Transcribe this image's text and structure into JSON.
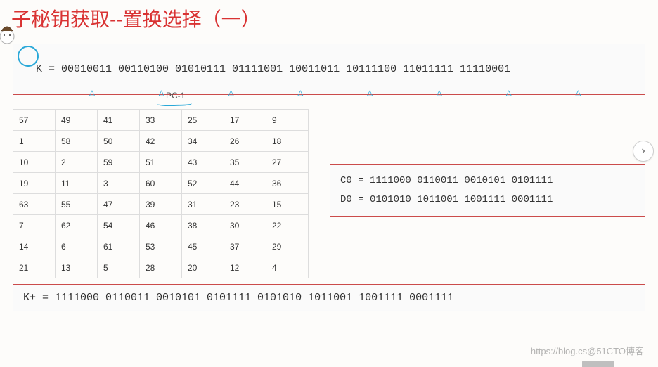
{
  "title": "子秘钥获取--置换选择（一）",
  "k_box": "K = 00010011 00110100 01010111 01111001 10011011 10111100 11011111 11110001",
  "pc1_label": "PC-1",
  "chart_data": {
    "type": "table",
    "title": "PC-1",
    "rows": [
      [
        57,
        49,
        41,
        33,
        25,
        17,
        9
      ],
      [
        1,
        58,
        50,
        42,
        34,
        26,
        18
      ],
      [
        10,
        2,
        59,
        51,
        43,
        35,
        27
      ],
      [
        19,
        11,
        3,
        60,
        52,
        44,
        36
      ],
      [
        63,
        55,
        47,
        39,
        31,
        23,
        15
      ],
      [
        7,
        62,
        54,
        46,
        38,
        30,
        22
      ],
      [
        14,
        6,
        61,
        53,
        45,
        37,
        29
      ],
      [
        21,
        13,
        5,
        28,
        20,
        12,
        4
      ]
    ]
  },
  "cd_box": "C0 = 1111000 0110011 0010101 0101111\nD0 = 0101010 1011001 1001111 0001111",
  "kplus_box": "K+ = 1111000 0110011 0010101 0101111 0101010 1011001 1001111 0001111",
  "watermark": "https://blog.cs@51CTO博客",
  "nav_icon": "›"
}
